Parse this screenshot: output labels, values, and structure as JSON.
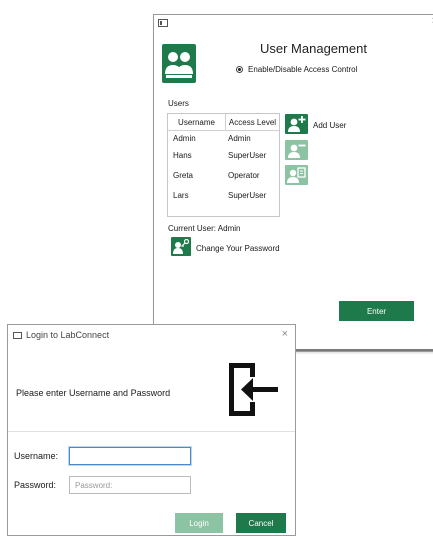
{
  "user_management": {
    "title": "User Management",
    "access_control_label": "Enable/Disable Access Control",
    "users_label": "Users",
    "table": {
      "headers": [
        "Username",
        "Access Level"
      ],
      "rows": [
        [
          "Admin",
          "Admin"
        ],
        [
          "Hans",
          "SuperUser"
        ],
        [
          "Greta",
          "Operator"
        ],
        [
          "Lars",
          "SuperUser"
        ]
      ]
    },
    "add_user_label": "Add User",
    "current_user": "Current User: Admin",
    "change_password_label": "Change Your Password",
    "enter_label": "Enter",
    "icons": [
      "users-logo-icon",
      "add-user-icon",
      "remove-user-icon",
      "edit-user-icon",
      "key-user-icon"
    ]
  },
  "login_dialog": {
    "title": "Login to LabConnect",
    "prompt": "Please enter Username and Password",
    "username_label": "Username:",
    "username_value": "",
    "password_label": "Password:",
    "password_placeholder": "Password:",
    "login_label": "Login",
    "cancel_label": "Cancel",
    "icons": [
      "login-door-icon"
    ]
  },
  "colors": {
    "accent_green": "#1f7a4b",
    "disabled_green": "#8cc3a3",
    "focus_blue": "#4a8ac9"
  }
}
